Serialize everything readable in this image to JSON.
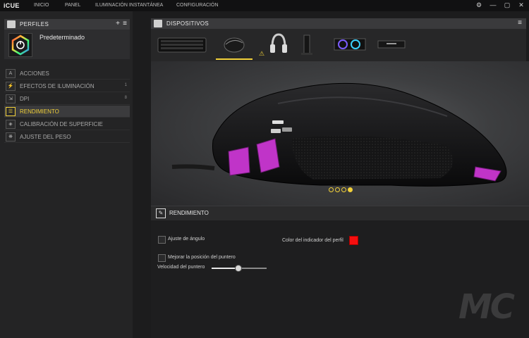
{
  "app": {
    "title": "iCUE"
  },
  "nav": [
    "INICIO",
    "PANEL",
    "ILUMINACIÓN INSTANTÁNEA",
    "CONFIGURACIÓN"
  ],
  "window_controls": {
    "settings": "⚙",
    "minimize": "—",
    "maximize": "▢",
    "close": "✕"
  },
  "profiles": {
    "header": "PERFILES",
    "add": "+",
    "menu": "≡",
    "current": "Predeterminado"
  },
  "menu_items": [
    {
      "label": "ACCIONES",
      "icon": "A",
      "badge": ""
    },
    {
      "label": "EFECTOS DE ILUMINACIÓN",
      "icon": "⚡",
      "badge": "1"
    },
    {
      "label": "DPI",
      "icon": "⇲",
      "badge": "8"
    },
    {
      "label": "RENDIMIENTO",
      "icon": "☰",
      "badge": "",
      "active": true
    },
    {
      "label": "CALIBRACIÓN DE SUPERFICIE",
      "icon": "◈",
      "badge": ""
    },
    {
      "label": "AJUSTE DEL PESO",
      "icon": "❋",
      "badge": ""
    }
  ],
  "devices": {
    "header": "DISPOSITIVOS",
    "menu": "≡",
    "items": [
      "keyboard",
      "mouse",
      "headset",
      "headset-stand",
      "cooler",
      "memory"
    ],
    "selected": 1,
    "warning_icon": "⚠"
  },
  "carousel": {
    "count": 4,
    "active": 3
  },
  "performance": {
    "header": "RENDIMIENTO",
    "angle_snap": {
      "label": "Ajuste de ángulo",
      "checked": false
    },
    "pointer_precision": {
      "label": "Mejorar la posición del puntero",
      "checked": false
    },
    "pointer_speed": {
      "label": "Velocidad del puntero",
      "value": 0.48
    },
    "profile_indicator": {
      "label": "Color del indicador del perfil",
      "color": "#f50f0f"
    }
  },
  "watermark": "MC",
  "colors": {
    "accent": "#f2d13a",
    "led": "#c034c8",
    "bg": "#1c1c1d"
  }
}
